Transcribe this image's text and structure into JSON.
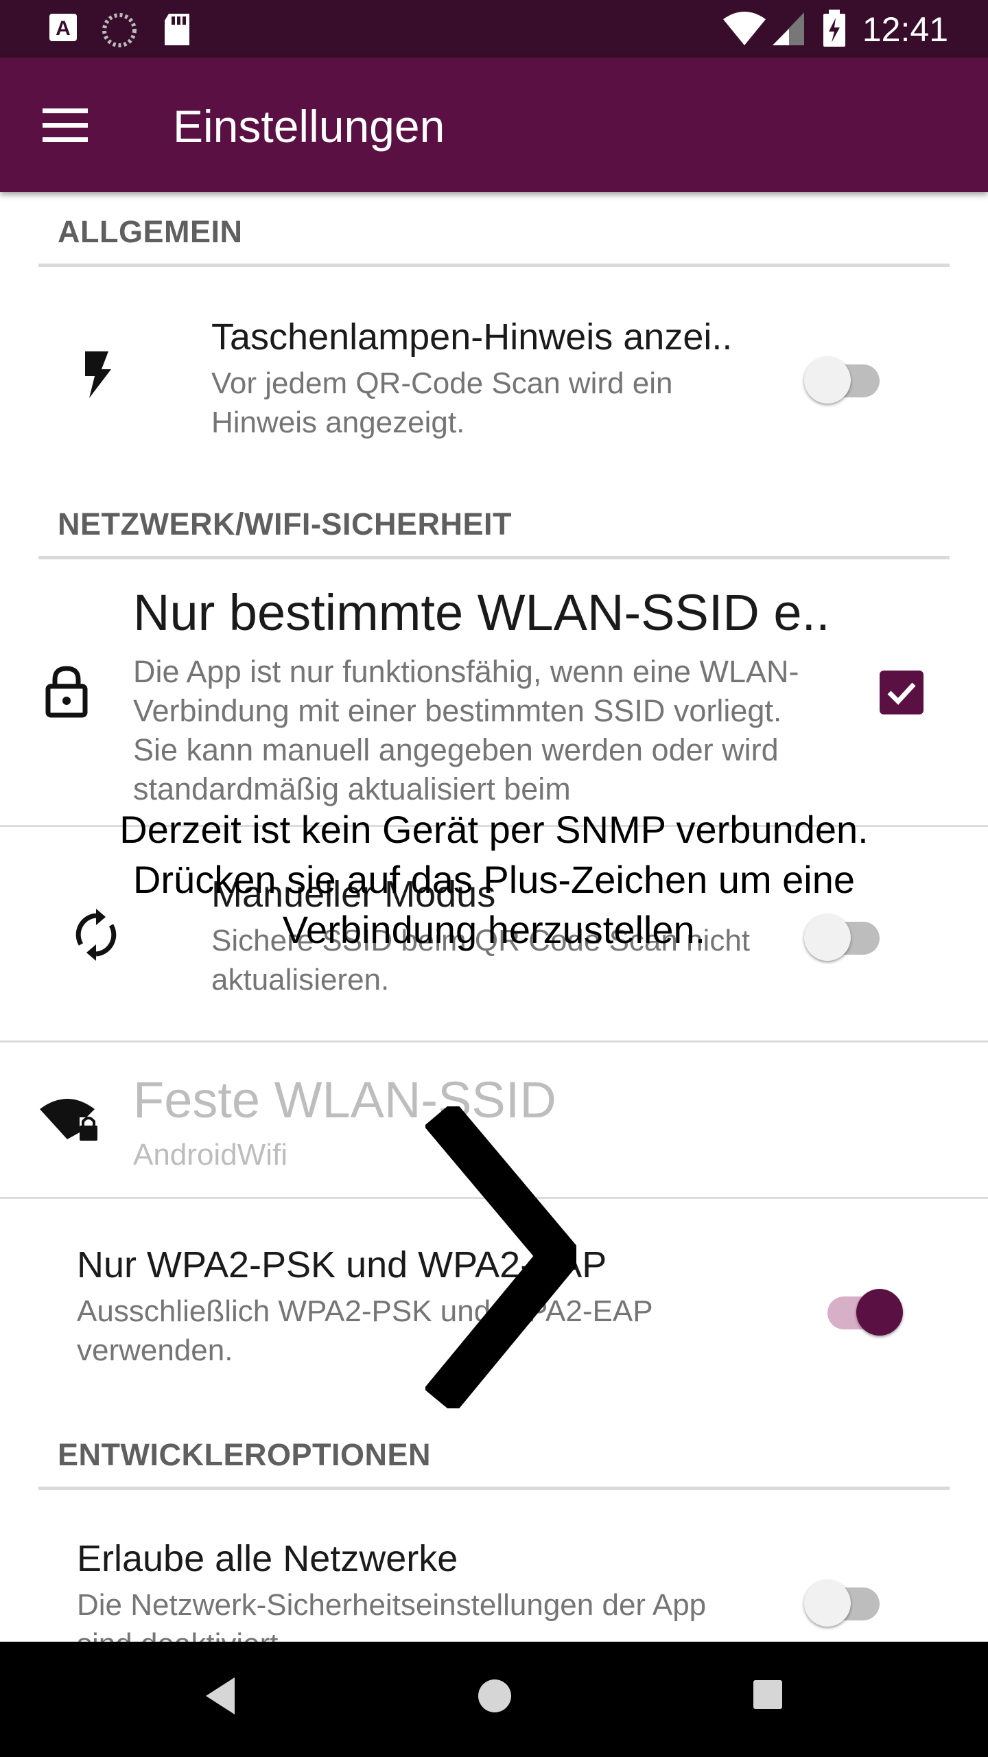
{
  "status_bar": {
    "time": "12:41",
    "left_icons": [
      "a-notification-icon",
      "loading-icon",
      "sd-card-icon"
    ],
    "right_icons": [
      "wifi-icon",
      "signal-icon",
      "battery-charging-icon"
    ]
  },
  "app_bar": {
    "title": "Einstellungen",
    "menu_icon": "hamburger-menu-icon",
    "color": "#5b1044"
  },
  "sections": {
    "general": {
      "header": "ALLGEMEIN",
      "flashlight": {
        "title": "Taschenlampen-Hinweis anzei..",
        "summary": "Vor jedem QR-Code Scan wird ein Hinweis angezeigt.",
        "icon": "flash-icon",
        "enabled": false
      }
    },
    "network": {
      "header": "NETZWERK/WIFI-SICHERHEIT",
      "ssid_only": {
        "title": "Nur bestimmte WLAN-SSID e..",
        "summary": "Die App ist nur funktionsfähig, wenn eine WLAN-Verbindung mit einer bestimmten SSID vorliegt. Sie kann manuell angegeben werden oder wird standardmäßig aktualisiert beim",
        "icon": "lock-icon",
        "checked": true
      },
      "manual_mode": {
        "title": "Manueller Modus",
        "summary": "Sichere SSID beim QR Code Scan nicht aktualisieren.",
        "icon": "sync-icon",
        "enabled": false
      },
      "fixed_ssid": {
        "title": "Feste WLAN-SSID",
        "summary": "AndroidWifi",
        "icon": "wifi-lock-icon"
      },
      "wpa2_only": {
        "title": "Nur WPA2-PSK und WPA2-EAP",
        "summary": "Ausschließlich WPA2-PSK und WPA2-EAP verwenden.",
        "enabled": true
      }
    },
    "developer": {
      "header": "ENTWICKLEROPTIONEN",
      "allow_all": {
        "title": "Erlaube alle Netzwerke",
        "summary": "Die Netzwerk-Sicherheitseinstellungen der App sind deaktiviert",
        "enabled": false
      }
    }
  },
  "overlay": {
    "message": "Derzeit ist kein Gerät per SNMP verbunden. Drücken sie auf das Plus-Zeichen um eine Verbindung herzustellen.",
    "arrow_icon": "chevron-right-icon"
  },
  "nav_bar": {
    "buttons": [
      "back-icon",
      "home-icon",
      "recents-icon"
    ]
  }
}
